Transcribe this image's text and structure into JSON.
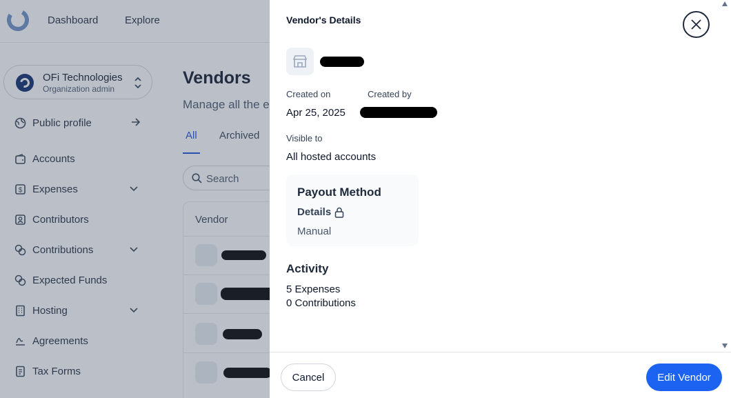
{
  "topnav": {
    "items": [
      "Dashboard",
      "Explore"
    ]
  },
  "org": {
    "name": "OFi Technologies",
    "role": "Organization admin"
  },
  "sidebar": {
    "public_profile": "Public profile",
    "items": [
      {
        "label": "Accounts",
        "icon": "wallet-icon"
      },
      {
        "label": "Expenses",
        "icon": "receipt-icon"
      },
      {
        "label": "Contributors",
        "icon": "contact-icon"
      },
      {
        "label": "Contributions",
        "icon": "coins-icon"
      },
      {
        "label": "Expected Funds",
        "icon": "coins-icon"
      },
      {
        "label": "Hosting",
        "icon": "building-icon"
      },
      {
        "label": "Agreements",
        "icon": "signature-icon"
      },
      {
        "label": "Tax Forms",
        "icon": "document-icon"
      }
    ]
  },
  "main": {
    "title": "Vendors",
    "subtitle": "Manage all the e",
    "tabs": [
      "All",
      "Archived"
    ],
    "search_label": "Search",
    "table_header": "Vendor"
  },
  "drawer": {
    "title": "Vendor's Details",
    "created_on_label": "Created on",
    "created_on_value": "Apr 25, 2025",
    "created_by_label": "Created by",
    "visible_to_label": "Visible to",
    "visible_to_value": "All hosted accounts",
    "payout": {
      "title": "Payout Method",
      "details_label": "Details",
      "method": "Manual"
    },
    "activity": {
      "title": "Activity",
      "expenses": "5 Expenses",
      "contributions": "0 Contributions"
    },
    "cancel_label": "Cancel",
    "edit_label": "Edit Vendor"
  },
  "colors": {
    "accent": "#1b63f0",
    "active_tab": "#1d4ed8",
    "overlay": "#475569"
  }
}
